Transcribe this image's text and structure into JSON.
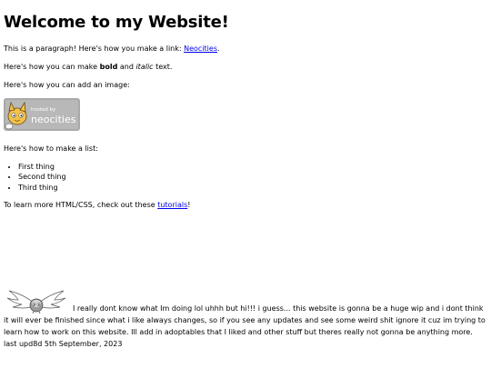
{
  "page": {
    "title": "Welcome to my Website!",
    "intro_prefix": "This is a paragraph! Here's how you make a link: ",
    "intro_link": "Neocities",
    "intro_suffix": ".",
    "format_prefix": "Here's how you can make ",
    "format_bold": "bold",
    "format_middle": " and ",
    "format_italic": "italic",
    "format_suffix": " text.",
    "image_intro": "Here's how you can add an image:",
    "badge": {
      "line1": "hosted by",
      "line2": "neocities"
    },
    "list_intro": "Here's how to make a list:",
    "list_items": [
      "First thing",
      "Second thing",
      "Third thing"
    ],
    "learn_prefix": "To learn more HTML/CSS, check out these ",
    "learn_link": "tutorials",
    "learn_suffix": "!",
    "bottom_text": "I really dont know what Im doing lol uhhh but hi!!! i guess... this website is gonna be a huge wip and i dont think it will ever be finished since what i like always changes, so if you see any updates and see some weird shit ignore it cuz im trying to learn how to work on this website. Ill add in adoptables that I liked and other stuff but theres really not gonna be anything more. last upd8d 5th September, 2023"
  },
  "colors": {
    "link": "#0000ee",
    "badge_bg": "#b8b8b8",
    "badge_text": "#ffffff"
  }
}
